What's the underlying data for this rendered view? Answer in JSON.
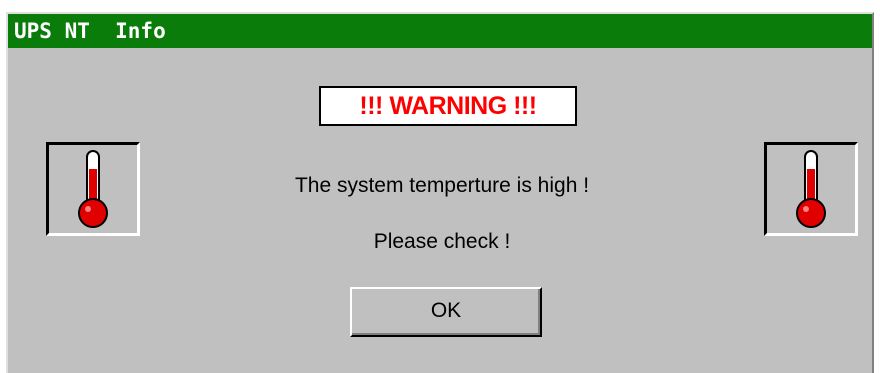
{
  "window": {
    "title": "UPS NT  Info"
  },
  "dialog": {
    "warning_label": "!!! WARNING !!!",
    "message_line1": "The system temperture is high !",
    "message_line2": "Please check !",
    "ok_label": "OK"
  },
  "icons": {
    "left": "thermometer-icon",
    "right": "thermometer-icon"
  },
  "colors": {
    "titlebar": "#0a7c0a",
    "warning_text": "#ff0000",
    "thermometer_fluid": "#e00000",
    "background": "#c0c0c0"
  }
}
